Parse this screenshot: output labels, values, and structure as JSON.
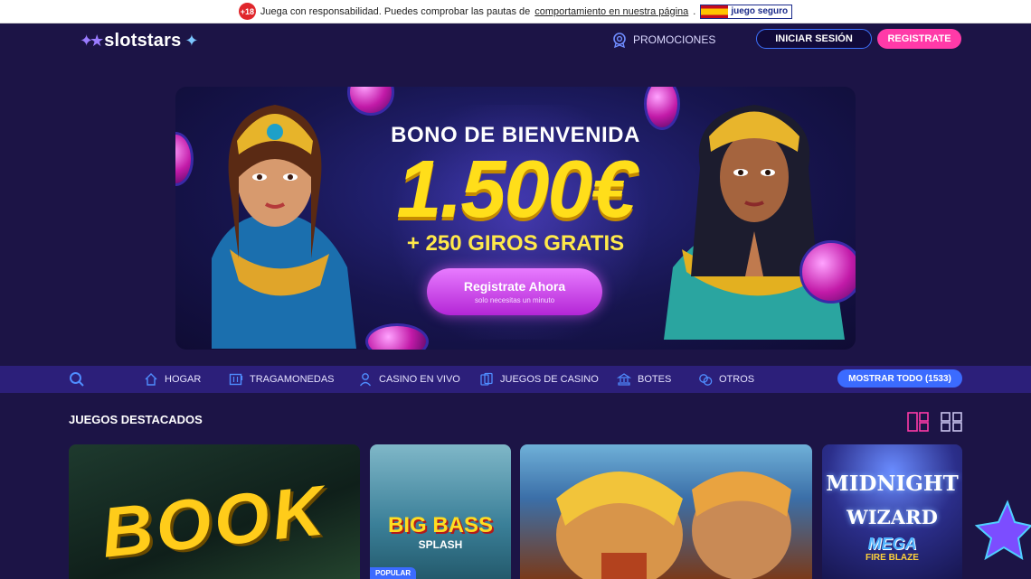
{
  "topbar": {
    "age_badge": "+18",
    "text": "Juega con responsabilidad. Puedes comprobar las pautas de",
    "link": "comportamiento en nuestra página",
    "period": ".",
    "safe_badge": "juego seguro"
  },
  "header": {
    "logo": "slotstars",
    "promotions_label": "PROMOCIONES",
    "login_label": "INICIAR SESIÓN",
    "register_label": "REGISTRATE"
  },
  "hero": {
    "title": "BONO DE BIENVENIDA",
    "amount": "1.500€",
    "subtitle": "+ 250 GIROS GRATIS",
    "cta_label": "Registrate Ahora",
    "cta_sub": "solo necesitas un minuto"
  },
  "nav": {
    "items": [
      {
        "label": "HOGAR",
        "icon": "home-icon"
      },
      {
        "label": "TRAGAMONEDAS",
        "icon": "slot-machine-icon"
      },
      {
        "label": "CASINO EN VIVO",
        "icon": "person-icon"
      },
      {
        "label": "JUEGOS DE CASINO",
        "icon": "cards-icon"
      },
      {
        "label": "BOTES",
        "icon": "jackpot-icon"
      },
      {
        "label": "OTROS",
        "icon": "chips-icon"
      }
    ],
    "show_all_label": "MOSTRAR TODO (1533)"
  },
  "featured": {
    "title": "JUEGOS DESTACADOS",
    "games": [
      {
        "title": "BOOK",
        "badge": ""
      },
      {
        "title": "BIG BASS",
        "subtitle": "SPLASH",
        "badge": "POPULAR"
      },
      {
        "title": "",
        "badge": ""
      },
      {
        "title": "MIDNIGHT",
        "subtitle": "WIZARD",
        "extra": "MEGA",
        "extra2": "FIRE BLAZE",
        "badge": ""
      }
    ]
  },
  "colors": {
    "background": "#1c1446",
    "nav_bar": "#2c1f7a",
    "accent_pink": "#ff3aa8",
    "accent_blue": "#3b6bff",
    "bonus_yellow": "#ffde1a"
  }
}
